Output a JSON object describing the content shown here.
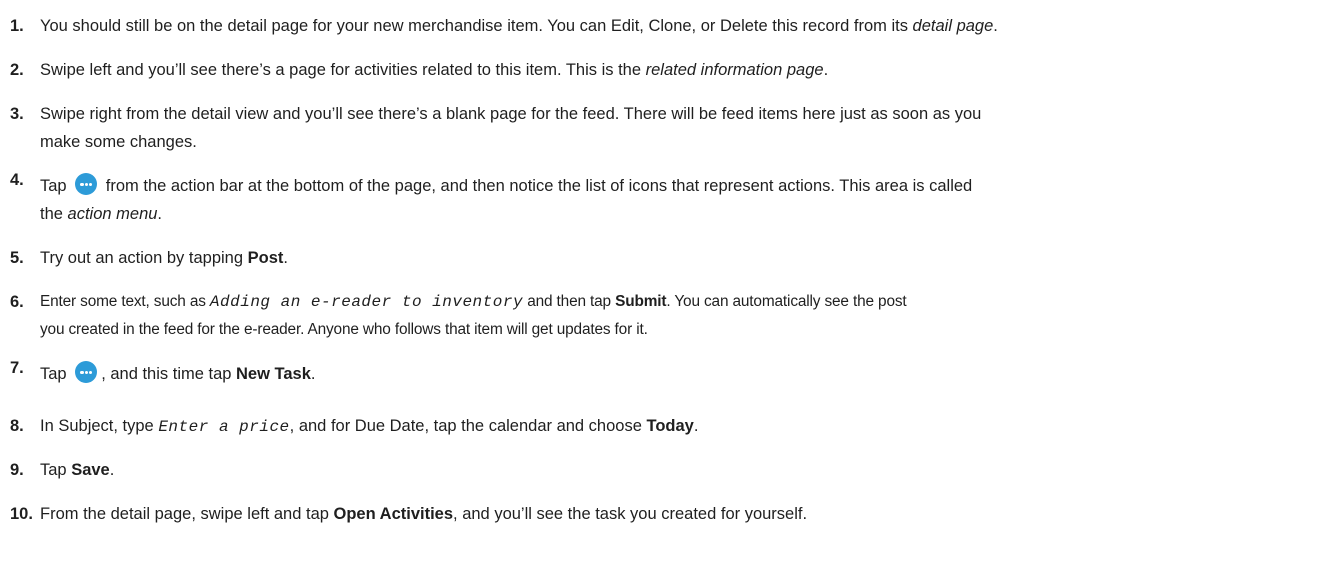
{
  "steps": [
    {
      "num": "1.",
      "parts": [
        {
          "text": "You should still be on the detail page for your new merchandise item. You can Edit, Clone, or Delete this record from its "
        },
        {
          "text": "detail page",
          "style": "em"
        },
        {
          "text": "."
        }
      ]
    },
    {
      "num": "2.",
      "parts": [
        {
          "text": "Swipe left and you’ll see there’s a page for activities related to this item. This is the "
        },
        {
          "text": "related information page",
          "style": "em"
        },
        {
          "text": "."
        }
      ]
    },
    {
      "num": "3.",
      "parts": [
        {
          "text": "Swipe right from the detail view and you’ll see there’s a blank page for the feed. There will be feed items here just as soon as you"
        },
        {
          "break": true
        },
        {
          "text": "make some changes."
        }
      ]
    },
    {
      "num": "4.",
      "parts": [
        {
          "text": "Tap "
        },
        {
          "icon": "more-actions-icon"
        },
        {
          "text": " from the action bar at the bottom of the page, and then notice the list of icons that represent actions. This area is called"
        },
        {
          "break": true
        },
        {
          "text": "the "
        },
        {
          "text": "action menu",
          "style": "em"
        },
        {
          "text": "."
        }
      ]
    },
    {
      "num": "5.",
      "parts": [
        {
          "text": "Try out an action by tapping "
        },
        {
          "text": "Post",
          "style": "strong"
        },
        {
          "text": "."
        }
      ]
    },
    {
      "num": "6.",
      "parts": [
        {
          "text": "Enter some text, such as "
        },
        {
          "text": "Adding an e-reader to inventory",
          "style": "code"
        },
        {
          "text": " and then tap "
        },
        {
          "text": "Submit",
          "style": "strong"
        },
        {
          "text": ". You can automatically see the post"
        },
        {
          "break": true
        },
        {
          "text": "you created in the feed for the e-reader. Anyone who follows that item will get updates for it."
        }
      ]
    },
    {
      "num": "7.",
      "parts": [
        {
          "text": "Tap "
        },
        {
          "icon": "more-actions-icon"
        },
        {
          "text": ", and this time tap "
        },
        {
          "text": "New Task",
          "style": "strong"
        },
        {
          "text": "."
        }
      ]
    },
    {
      "num": "8.",
      "parts": [
        {
          "text": "In Subject, type "
        },
        {
          "text": "Enter a price",
          "style": "code"
        },
        {
          "text": ", and for Due Date, tap the calendar and choose "
        },
        {
          "text": "Today",
          "style": "strong"
        },
        {
          "text": "."
        }
      ]
    },
    {
      "num": "9.",
      "parts": [
        {
          "text": "Tap "
        },
        {
          "text": "Save",
          "style": "strong"
        },
        {
          "text": "."
        }
      ]
    },
    {
      "num": "10.",
      "parts": [
        {
          "text": "From the detail page, swipe left and tap "
        },
        {
          "text": "Open Activities",
          "style": "strong"
        },
        {
          "text": ", and you’ll see the task you created for yourself."
        }
      ]
    }
  ]
}
